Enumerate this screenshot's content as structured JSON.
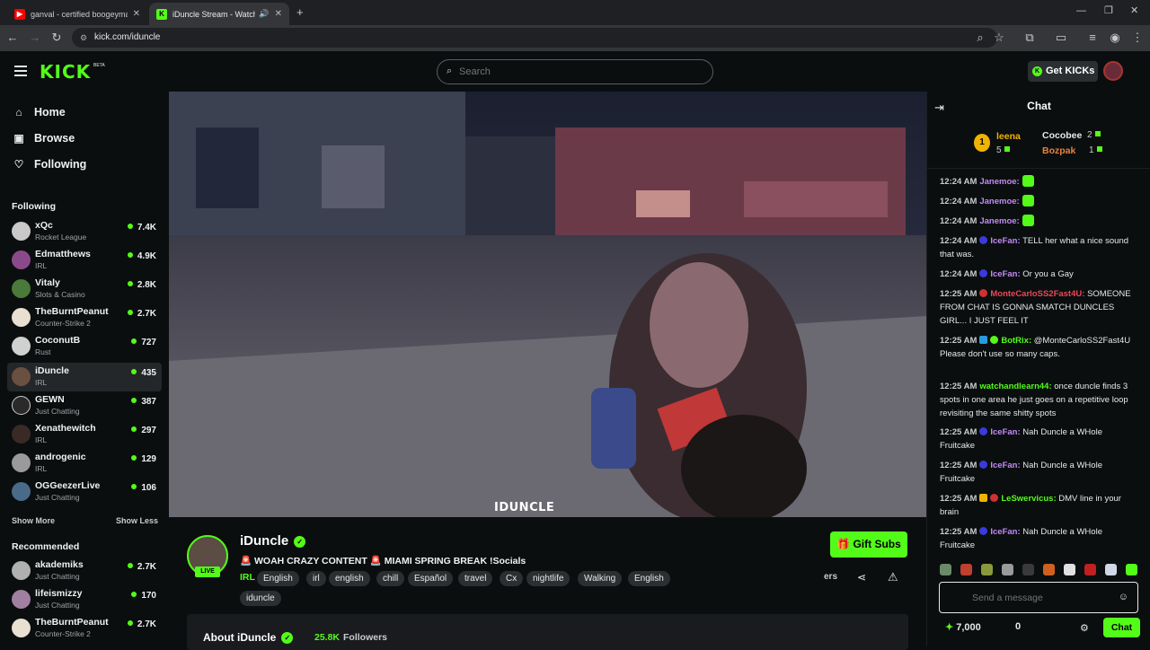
{
  "browser": {
    "tabs": [
      {
        "title": "ganval - certified boogeyman -",
        "icon": "youtube-icon"
      },
      {
        "title": "iDuncle Stream - Watch Live",
        "icon": "kick-icon"
      }
    ],
    "url": "kick.com/iduncle"
  },
  "header": {
    "logo": "KICK",
    "beta": "BETA",
    "search_placeholder": "Search",
    "get_kicks_label": "Get KICKs",
    "colors": {
      "brand": "#53fc18",
      "bg": "#0b0e0f"
    }
  },
  "sidebar": {
    "nav": [
      {
        "label": "Home",
        "icon": "home-icon"
      },
      {
        "label": "Browse",
        "icon": "browse-icon"
      },
      {
        "label": "Following",
        "icon": "heart-icon"
      }
    ],
    "following_title": "Following",
    "following": [
      {
        "name": "xQc",
        "category": "Rocket League",
        "viewers": "7.4K"
      },
      {
        "name": "Edmatthews",
        "category": "IRL",
        "viewers": "4.9K"
      },
      {
        "name": "Vitaly",
        "category": "Slots & Casino",
        "viewers": "2.8K"
      },
      {
        "name": "TheBurntPeanut",
        "category": "Counter-Strike 2",
        "viewers": "2.7K"
      },
      {
        "name": "CoconutB",
        "category": "Rust",
        "viewers": "727"
      },
      {
        "name": "iDuncle",
        "category": "IRL",
        "viewers": "435"
      },
      {
        "name": "GEWN",
        "category": "Just Chatting",
        "viewers": "387"
      },
      {
        "name": "Xenathewitch",
        "category": "IRL",
        "viewers": "297"
      },
      {
        "name": "androgenic",
        "category": "IRL",
        "viewers": "129"
      },
      {
        "name": "OGGeezerLive",
        "category": "Just Chatting",
        "viewers": "106"
      }
    ],
    "show_more": "Show More",
    "show_less": "Show Less",
    "recommended_title": "Recommended",
    "recommended": [
      {
        "name": "akademiks",
        "category": "Just Chatting",
        "viewers": "2.7K"
      },
      {
        "name": "lifeismizzy",
        "category": "Just Chatting",
        "viewers": "170"
      },
      {
        "name": "TheBurntPeanut",
        "category": "Counter-Strike 2",
        "viewers": "2.7K"
      }
    ]
  },
  "video": {
    "watermark": "IDUNCLE"
  },
  "channel": {
    "name": "iDuncle",
    "live_label": "LIVE",
    "stream_title": "🚨 WOAH CRAZY CONTENT 🚨 MIAMI SPRING BREAK !Socials",
    "category": "IRL",
    "tags": [
      "English",
      "irl",
      "english",
      "chill",
      "Español",
      "travel",
      "Cx",
      "nightlife",
      "Walking",
      "English",
      "iduncle"
    ],
    "gift_subs_label": "Gift Subs",
    "followers_truncated": "ers",
    "about_title": "About iDuncle",
    "follower_count": "25.8K",
    "followers_label": "Followers"
  },
  "chat": {
    "title": "Chat",
    "leaderboard": [
      {
        "rank": "1",
        "name": "leena",
        "count": "5"
      },
      {
        "name": "Cocobee",
        "count": "2"
      },
      {
        "name": "Bozpak",
        "count": "1"
      }
    ],
    "messages": [
      {
        "time": "12:24 AM",
        "user": "Janemoe:",
        "text": "",
        "emote": true
      },
      {
        "time": "12:24 AM",
        "user": "Janemoe:",
        "text": "",
        "emote": true
      },
      {
        "time": "12:24 AM",
        "user": "Janemoe:",
        "text": "",
        "emote": true
      },
      {
        "time": "12:24 AM",
        "user": "IceFan:",
        "text": "TELL her what a nice sound that was."
      },
      {
        "time": "12:24 AM",
        "user": "IceFan:",
        "text": "Or you a Gay"
      },
      {
        "time": "12:25 AM",
        "user": "MonteCarloSS2Fast4U:",
        "text": "SOMEONE FROM CHAT IS GONNA SMATCH DUNCLES GIRL... I JUST FEEL IT"
      },
      {
        "time": "12:25 AM",
        "user": "BotRix:",
        "text": "@MonteCarloSS2Fast4U Please don't use so many caps."
      },
      {
        "time": "12:25 AM",
        "user": "watchandlearn44:",
        "text": "once duncle finds 3 spots in one area he just goes on a repetitive loop revisiting the same shitty spots"
      },
      {
        "time": "12:25 AM",
        "user": "IceFan:",
        "text": "Nah Duncle a WHole Fruitcake"
      },
      {
        "time": "12:25 AM",
        "user": "IceFan:",
        "text": "Nah Duncle a WHole Fruitcake"
      },
      {
        "time": "12:25 AM",
        "user": "LeSwervicus:",
        "text": "DMV line in your brain"
      },
      {
        "time": "12:25 AM",
        "user": "IceFan:",
        "text": "Nah Duncle a WHole Fruitcake"
      }
    ],
    "input_placeholder": "Send a message",
    "points": "7,000",
    "points_zero": "0",
    "send_label": "Chat"
  }
}
